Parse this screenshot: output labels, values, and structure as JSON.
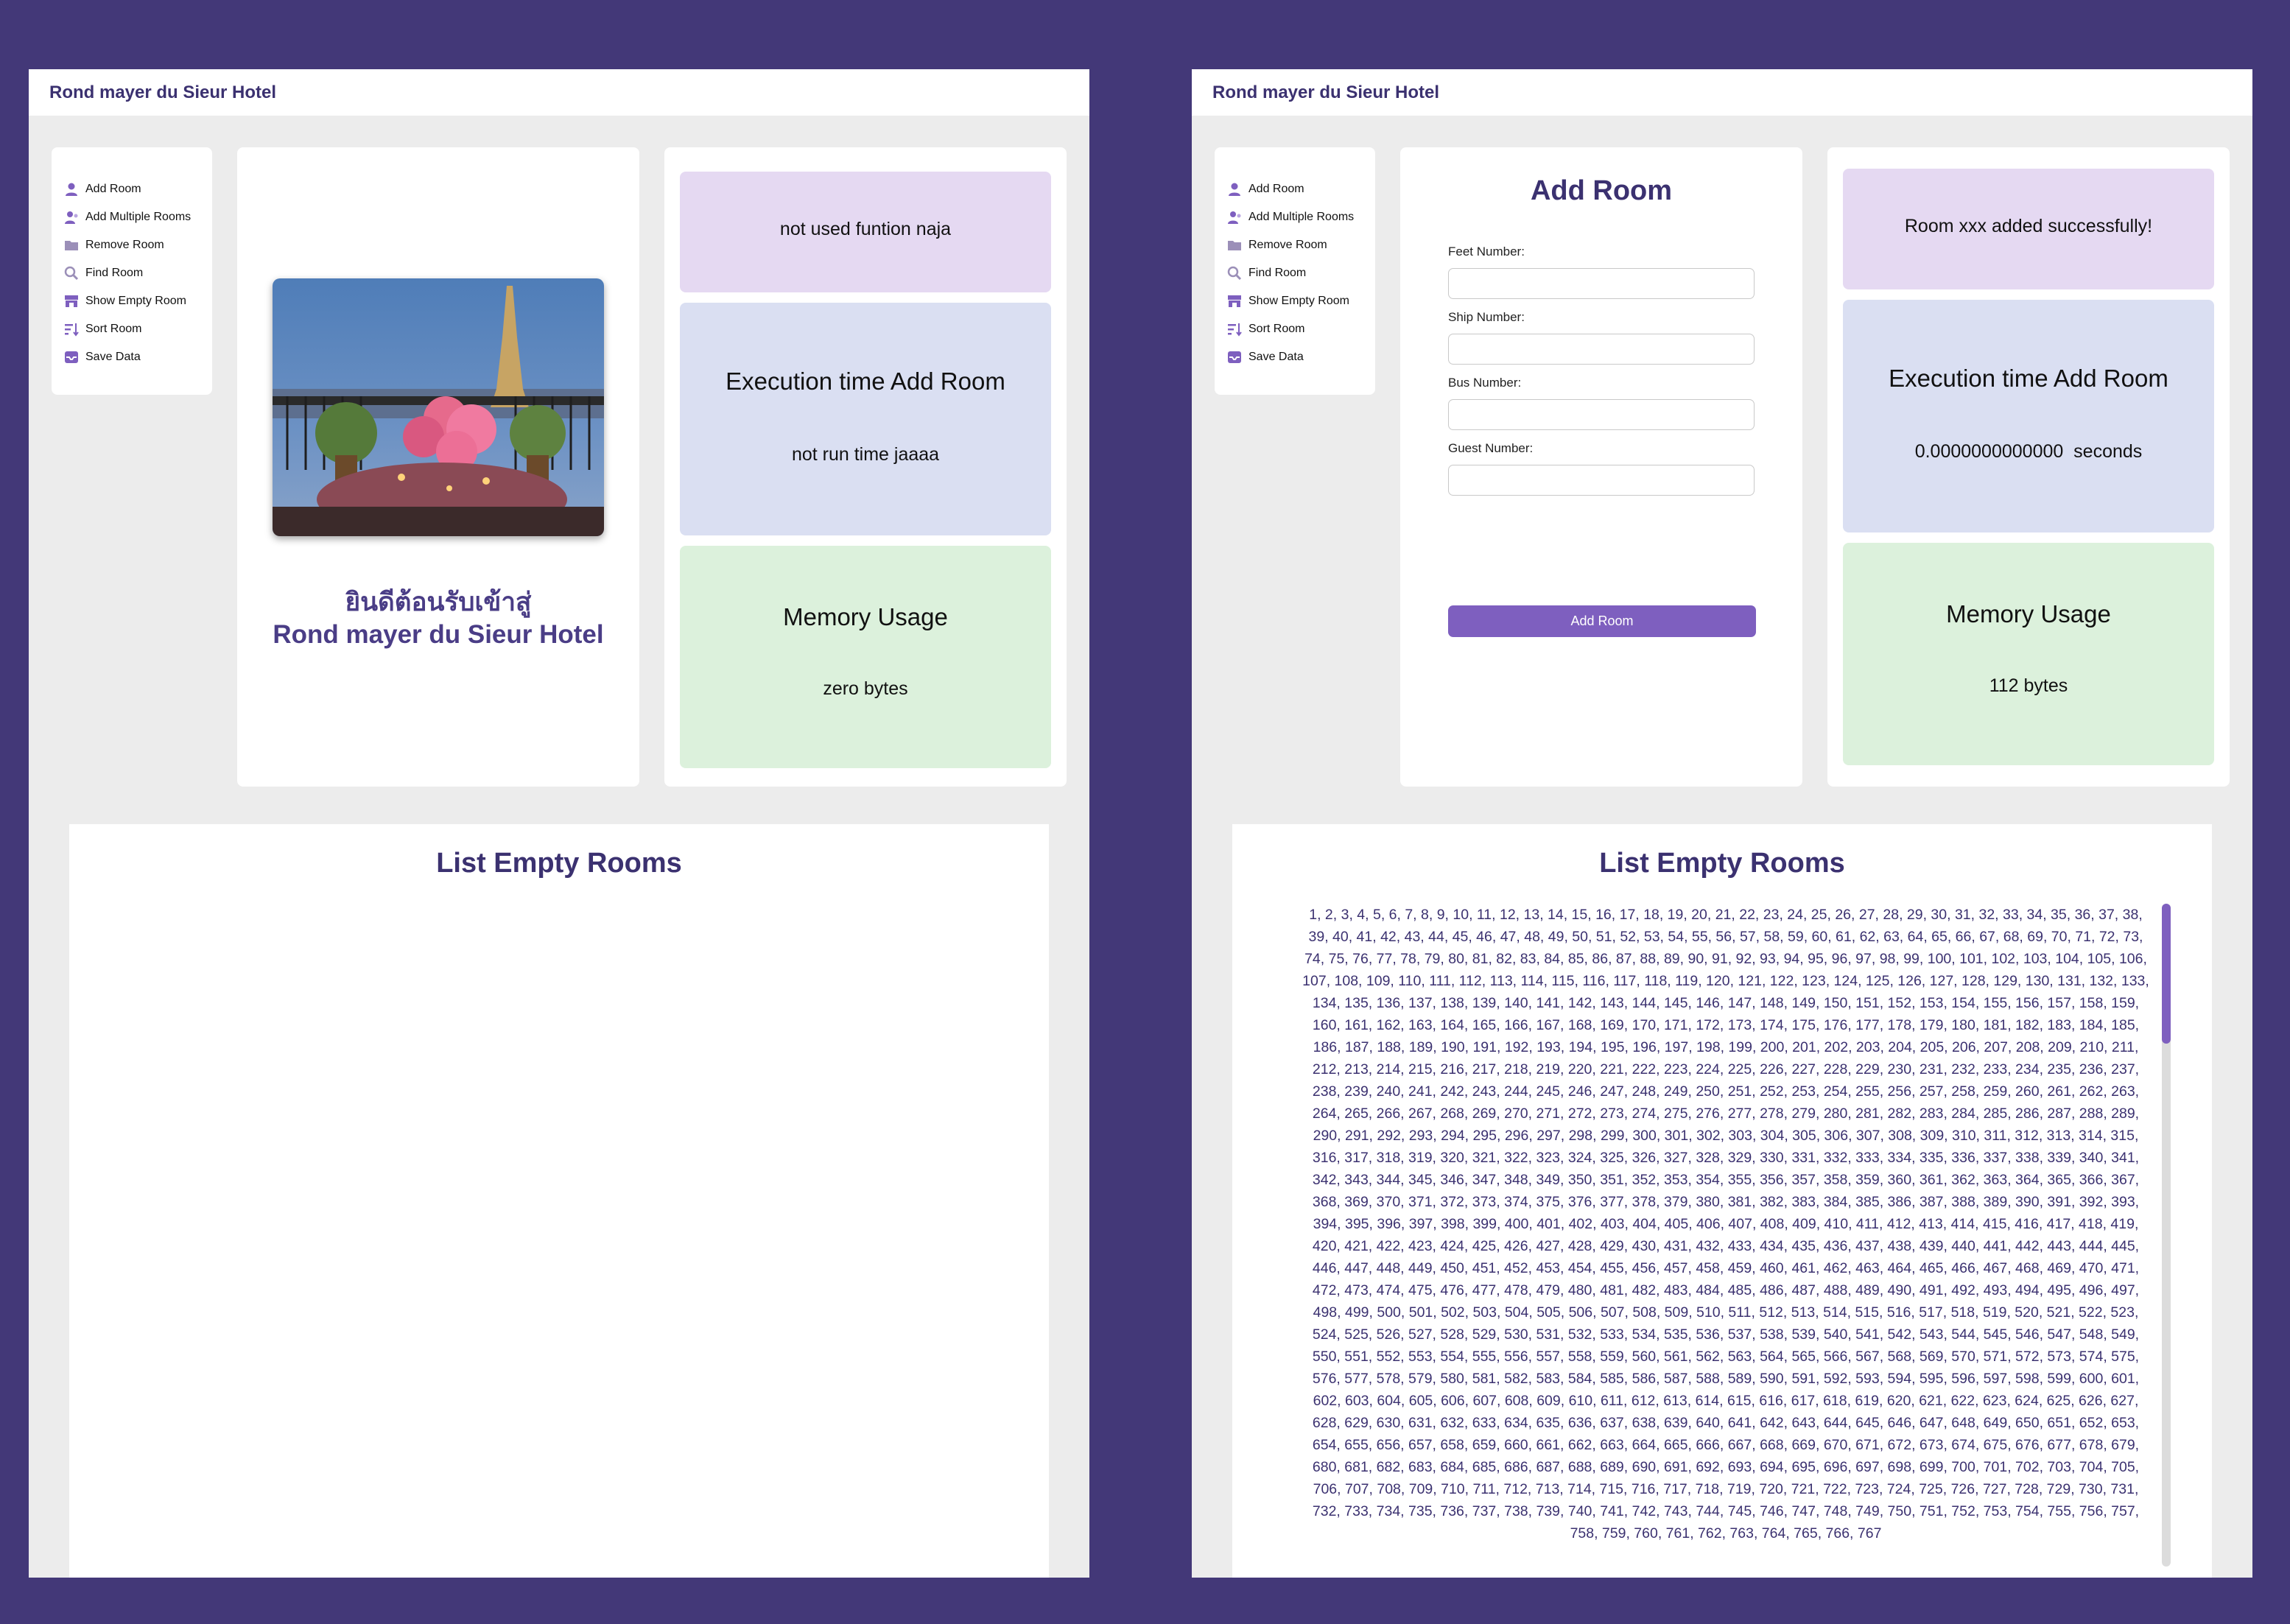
{
  "colors": {
    "background": "#433878",
    "accent": "#7e5fbf",
    "heading": "#3b3170",
    "card_message": "#e5d9f2",
    "card_time": "#dadff2",
    "card_memory": "#dcf1dc"
  },
  "header": {
    "title": "Rond mayer du Sieur Hotel"
  },
  "sidebar": {
    "items": [
      {
        "label": "Add Room",
        "icon": "person-icon"
      },
      {
        "label": "Add Multiple Rooms",
        "icon": "people-icon"
      },
      {
        "label": "Remove Room",
        "icon": "folder-icon"
      },
      {
        "label": "Find Room",
        "icon": "search-icon"
      },
      {
        "label": "Show Empty Room",
        "icon": "store-icon"
      },
      {
        "label": "Sort Room",
        "icon": "sort-icon"
      },
      {
        "label": "Save Data",
        "icon": "inbox-icon"
      }
    ]
  },
  "left_screen": {
    "welcome": {
      "line1": "ยินดีต้อนรับเข้าสู่",
      "line2": "Rond mayer du Sieur Hotel",
      "image": "eiffel-tower-dinner-photo"
    },
    "message": "not used funtion naja",
    "execution": {
      "title": "Execution time Add Room",
      "value": "not run time jaaaa"
    },
    "memory": {
      "title": "Memory Usage",
      "value": "zero bytes"
    },
    "list_title": "List Empty Rooms"
  },
  "right_screen": {
    "form": {
      "title": "Add Room",
      "fields": [
        {
          "label": "Feet Number:",
          "value": ""
        },
        {
          "label": "Ship Number:",
          "value": ""
        },
        {
          "label": "Bus Number:",
          "value": ""
        },
        {
          "label": "Guest Number:",
          "value": ""
        }
      ],
      "button": "Add Room"
    },
    "message": "Room xxx added successfully!",
    "execution": {
      "title": "Execution time Add Room",
      "value": "0.0000000000000  seconds"
    },
    "memory": {
      "title": "Memory Usage",
      "value": "112 bytes"
    },
    "list_title": "List Empty Rooms",
    "rooms_text": "1, 2, 3, 4, 5, 6, 7, 8, 9, 10, 11, 12, 13, 14, 15, 16, 17, 18, 19, 20, 21, 22, 23, 24, 25, 26, 27, 28, 29, 30, 31, 32, 33, 34, 35, 36, 37, 38, 39, 40, 41, 42, 43, 44, 45, 46, 47, 48, 49, 50, 51, 52, 53, 54, 55, 56, 57, 58, 59, 60, 61, 62, 63, 64, 65, 66, 67, 68, 69, 70, 71, 72, 73, 74, 75, 76, 77, 78, 79, 80, 81, 82, 83, 84, 85, 86, 87, 88, 89, 90, 91, 92, 93, 94, 95, 96, 97, 98, 99, 100, 101, 102, 103, 104, 105, 106, 107, 108, 109, 110, 111, 112, 113, 114, 115, 116, 117, 118, 119, 120, 121, 122, 123, 124, 125, 126, 127, 128, 129, 130, 131, 132, 133, 134, 135, 136, 137, 138, 139, 140, 141, 142, 143, 144, 145, 146, 147, 148, 149, 150, 151, 152, 153, 154, 155, 156, 157, 158, 159, 160, 161, 162, 163, 164, 165, 166, 167, 168, 169, 170, 171, 172, 173, 174, 175, 176, 177, 178, 179, 180, 181, 182, 183, 184, 185, 186, 187, 188, 189, 190, 191, 192, 193, 194, 195, 196, 197, 198, 199, 200, 201, 202, 203, 204, 205, 206, 207, 208, 209, 210, 211, 212, 213, 214, 215, 216, 217, 218, 219, 220, 221, 222, 223, 224, 225, 226, 227, 228, 229, 230, 231, 232, 233, 234, 235, 236, 237, 238, 239, 240, 241, 242, 243, 244, 245, 246, 247, 248, 249, 250, 251, 252, 253, 254, 255, 256, 257, 258, 259, 260, 261, 262, 263, 264, 265, 266, 267, 268, 269, 270, 271, 272, 273, 274, 275, 276, 277, 278, 279, 280, 281, 282, 283, 284, 285, 286, 287, 288, 289, 290, 291, 292, 293, 294, 295, 296, 297, 298, 299, 300, 301, 302, 303, 304, 305, 306, 307, 308, 309, 310, 311, 312, 313, 314, 315, 316, 317, 318, 319, 320, 321, 322, 323, 324, 325, 326, 327, 328, 329, 330, 331, 332, 333, 334, 335, 336, 337, 338, 339, 340, 341, 342, 343, 344, 345, 346, 347, 348, 349, 350, 351, 352, 353, 354, 355, 356, 357, 358, 359, 360, 361, 362, 363, 364, 365, 366, 367, 368, 369, 370, 371, 372, 373, 374, 375, 376, 377, 378, 379, 380, 381, 382, 383, 384, 385, 386, 387, 388, 389, 390, 391, 392, 393, 394, 395, 396, 397, 398, 399, 400, 401, 402, 403, 404, 405, 406, 407, 408, 409, 410, 411, 412, 413, 414, 415, 416, 417, 418, 419, 420, 421, 422, 423, 424, 425, 426, 427, 428, 429, 430, 431, 432, 433, 434, 435, 436, 437, 438, 439, 440, 441, 442, 443, 444, 445, 446, 447, 448, 449, 450, 451, 452, 453, 454, 455, 456, 457, 458, 459, 460, 461, 462, 463, 464, 465, 466, 467, 468, 469, 470, 471, 472, 473, 474, 475, 476, 477, 478, 479, 480, 481, 482, 483, 484, 485, 486, 487, 488, 489, 490, 491, 492, 493, 494, 495, 496, 497, 498, 499, 500, 501, 502, 503, 504, 505, 506, 507, 508, 509, 510, 511, 512, 513, 514, 515, 516, 517, 518, 519, 520, 521, 522, 523, 524, 525, 526, 527, 528, 529, 530, 531, 532, 533, 534, 535, 536, 537, 538, 539, 540, 541, 542, 543, 544, 545, 546, 547, 548, 549, 550, 551, 552, 553, 554, 555, 556, 557, 558, 559, 560, 561, 562, 563, 564, 565, 566, 567, 568, 569, 570, 571, 572, 573, 574, 575, 576, 577, 578, 579, 580, 581, 582, 583, 584, 585, 586, 587, 588, 589, 590, 591, 592, 593, 594, 595, 596, 597, 598, 599, 600, 601, 602, 603, 604, 605, 606, 607, 608, 609, 610, 611, 612, 613, 614, 615, 616, 617, 618, 619, 620, 621, 622, 623, 624, 625, 626, 627, 628, 629, 630, 631, 632, 633, 634, 635, 636, 637, 638, 639, 640, 641, 642, 643, 644, 645, 646, 647, 648, 649, 650, 651, 652, 653, 654, 655, 656, 657, 658, 659, 660, 661, 662, 663, 664, 665, 666, 667, 668, 669, 670, 671, 672, 673, 674, 675, 676, 677, 678, 679, 680, 681, 682, 683, 684, 685, 686, 687, 688, 689, 690, 691, 692, 693, 694, 695, 696, 697, 698, 699, 700, 701, 702, 703, 704, 705, 706, 707, 708, 709, 710, 711, 712, 713, 714, 715, 716, 717, 718, 719, 720, 721, 722, 723, 724, 725, 726, 727, 728, 729, 730, 731, 732, 733, 734, 735, 736, 737, 738, 739, 740, 741, 742, 743, 744, 745, 746, 747, 748, 749, 750, 751, 752, 753, 754, 755, 756, 757, 758, 759, 760, 761, 762, 763, 764, 765, 766, 767"
  }
}
